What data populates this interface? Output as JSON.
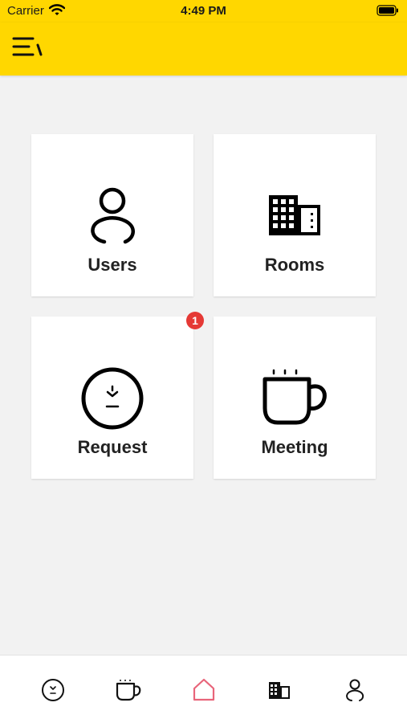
{
  "status_bar": {
    "carrier": "Carrier",
    "time": "4:49 PM",
    "wifi_icon": "wifi-icon",
    "battery_icon": "battery-icon"
  },
  "app_bar": {
    "menu_icon": "menu-icon",
    "background_color": "#ffd700"
  },
  "tiles": [
    {
      "label": "Users",
      "icon": "user-icon"
    },
    {
      "label": "Rooms",
      "icon": "building-icon"
    },
    {
      "label": "Request",
      "icon": "request-face-icon",
      "badge": "1"
    },
    {
      "label": "Meeting",
      "icon": "coffee-cup-icon"
    }
  ],
  "badge_color": "#e53935",
  "tab_bar": {
    "active_tab": "home",
    "active_color": "#e8657a",
    "tabs": [
      {
        "id": "request",
        "icon": "request-face-icon"
      },
      {
        "id": "meeting",
        "icon": "coffee-cup-icon"
      },
      {
        "id": "home",
        "icon": "home-icon"
      },
      {
        "id": "rooms",
        "icon": "building-icon"
      },
      {
        "id": "users",
        "icon": "user-icon"
      }
    ]
  }
}
